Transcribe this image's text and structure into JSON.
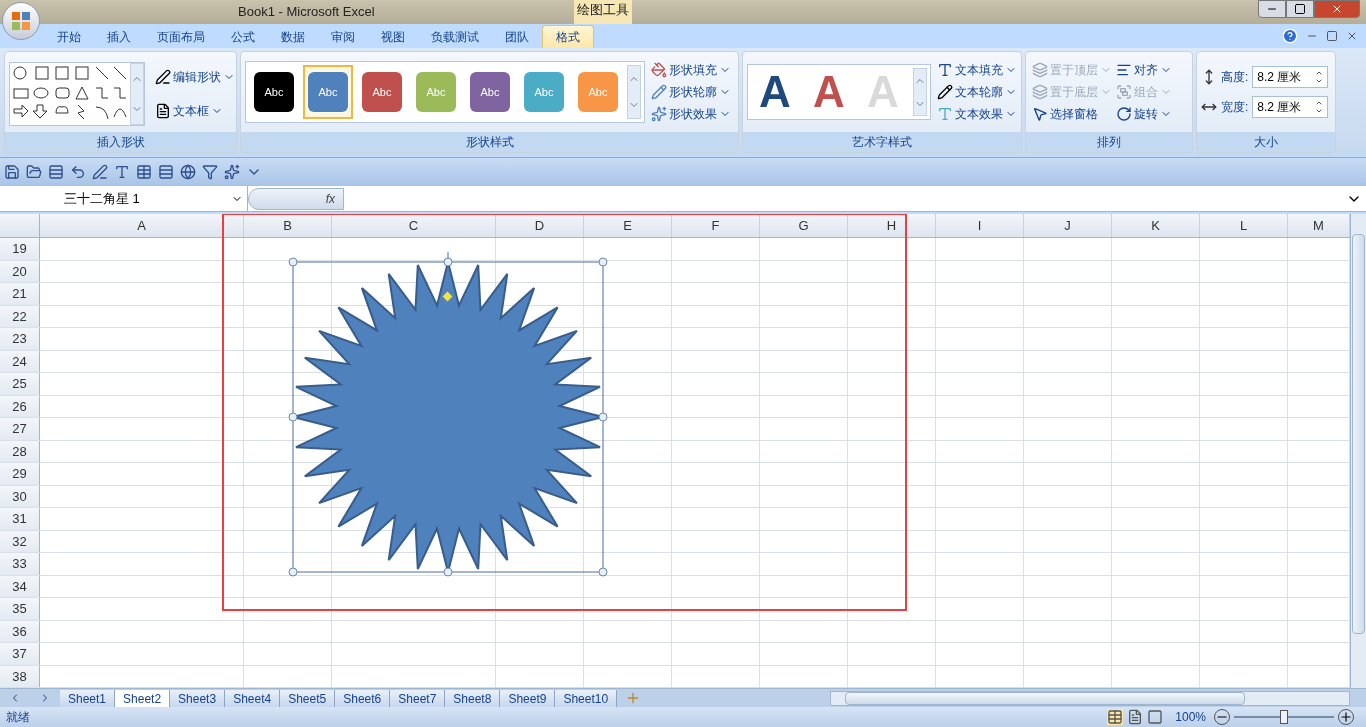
{
  "window": {
    "title": "Book1 - Microsoft Excel",
    "context_group": "绘图工具"
  },
  "ribbon_tabs": [
    {
      "label": "开始",
      "selected": false
    },
    {
      "label": "插入",
      "selected": false
    },
    {
      "label": "页面布局",
      "selected": false
    },
    {
      "label": "公式",
      "selected": false
    },
    {
      "label": "数据",
      "selected": false
    },
    {
      "label": "审阅",
      "selected": false
    },
    {
      "label": "视图",
      "selected": false
    },
    {
      "label": "负载测试",
      "selected": false
    },
    {
      "label": "团队",
      "selected": false
    },
    {
      "label": "格式",
      "selected": true
    }
  ],
  "insert_shapes": {
    "title": "插入形状",
    "commands": [
      "编辑形状",
      "文本框"
    ]
  },
  "shape_styles": {
    "title": "形状样式",
    "styles": [
      {
        "label": "Abc",
        "color": "#000000",
        "selected": false
      },
      {
        "label": "Abc",
        "color": "#4f81bd",
        "selected": true
      },
      {
        "label": "Abc",
        "color": "#c0504d",
        "selected": false
      },
      {
        "label": "Abc",
        "color": "#9bbb59",
        "selected": false
      },
      {
        "label": "Abc",
        "color": "#8064a2",
        "selected": false
      },
      {
        "label": "Abc",
        "color": "#4bacc6",
        "selected": false
      },
      {
        "label": "Abc",
        "color": "#f79646",
        "selected": false
      }
    ],
    "commands": [
      "形状填充",
      "形状轮廓",
      "形状效果"
    ]
  },
  "wordart_styles": {
    "title": "艺术字样式",
    "previews": [
      {
        "label": "A",
        "color": "#1f497d"
      },
      {
        "label": "A",
        "color": "#c0504d"
      },
      {
        "label": "A",
        "color": "#d9d9d9"
      }
    ],
    "commands": [
      "文本填充",
      "文本轮廓",
      "文本效果"
    ]
  },
  "arrange": {
    "title": "排列",
    "commands": [
      {
        "label": "置于顶层",
        "disabled": true
      },
      {
        "label": "对齐",
        "disabled": false
      },
      {
        "label": "置于底层",
        "disabled": true
      },
      {
        "label": "组合",
        "disabled": true
      },
      {
        "label": "选择窗格",
        "disabled": false
      },
      {
        "label": "旋转",
        "disabled": false
      }
    ]
  },
  "size": {
    "title": "大小",
    "fields": [
      {
        "label": "高度:",
        "value": "8.2 厘米"
      },
      {
        "label": "宽度:",
        "value": "8.2 厘米"
      }
    ]
  },
  "name_box": "三十二角星 1",
  "formula_button": "fx",
  "columns": [
    "A",
    "B",
    "C",
    "D",
    "E",
    "F",
    "G",
    "H",
    "I",
    "J",
    "K",
    "L",
    "M"
  ],
  "rows": [
    "19",
    "20",
    "21",
    "22",
    "23",
    "24",
    "25",
    "26",
    "27",
    "28",
    "29",
    "30",
    "31",
    "32",
    "33",
    "34",
    "35",
    "36",
    "37",
    "38"
  ],
  "sheet_tabs": [
    {
      "label": "Sheet1",
      "selected": false
    },
    {
      "label": "Sheet2",
      "selected": true
    },
    {
      "label": "Sheet3",
      "selected": false
    },
    {
      "label": "Sheet4",
      "selected": false
    },
    {
      "label": "Sheet5",
      "selected": false
    },
    {
      "label": "Sheet6",
      "selected": false
    },
    {
      "label": "Sheet7",
      "selected": false
    },
    {
      "label": "Sheet8",
      "selected": false
    },
    {
      "label": "Sheet9",
      "selected": false
    },
    {
      "label": "Sheet10",
      "selected": false
    }
  ],
  "status_bar": {
    "text": "就绪",
    "zoom": "100%",
    "zoom_slider": {
      "level": 0.5
    }
  }
}
